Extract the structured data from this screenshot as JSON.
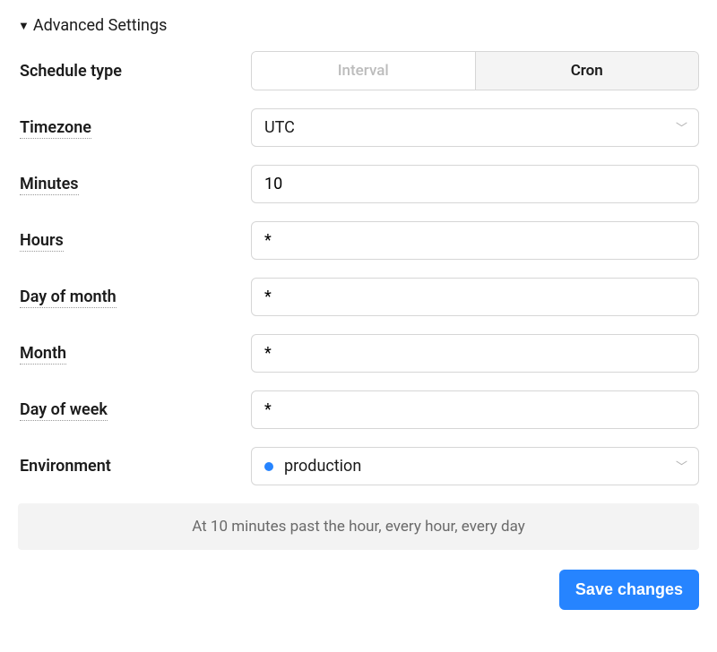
{
  "header": {
    "title": "Advanced Settings"
  },
  "labels": {
    "schedule_type": "Schedule type",
    "timezone": "Timezone",
    "minutes": "Minutes",
    "hours": "Hours",
    "day_of_month": "Day of month",
    "month": "Month",
    "day_of_week": "Day of week",
    "environment": "Environment"
  },
  "schedule_type": {
    "options": [
      "Interval",
      "Cron"
    ],
    "selected": "Cron"
  },
  "timezone": {
    "value": "UTC"
  },
  "cron": {
    "minutes": "10",
    "hours": "*",
    "day_of_month": "*",
    "month": "*",
    "day_of_week": "*"
  },
  "environment": {
    "name": "production",
    "color": "#2684ff"
  },
  "summary": "At 10 minutes past the hour, every hour, every day",
  "actions": {
    "save": "Save changes"
  }
}
